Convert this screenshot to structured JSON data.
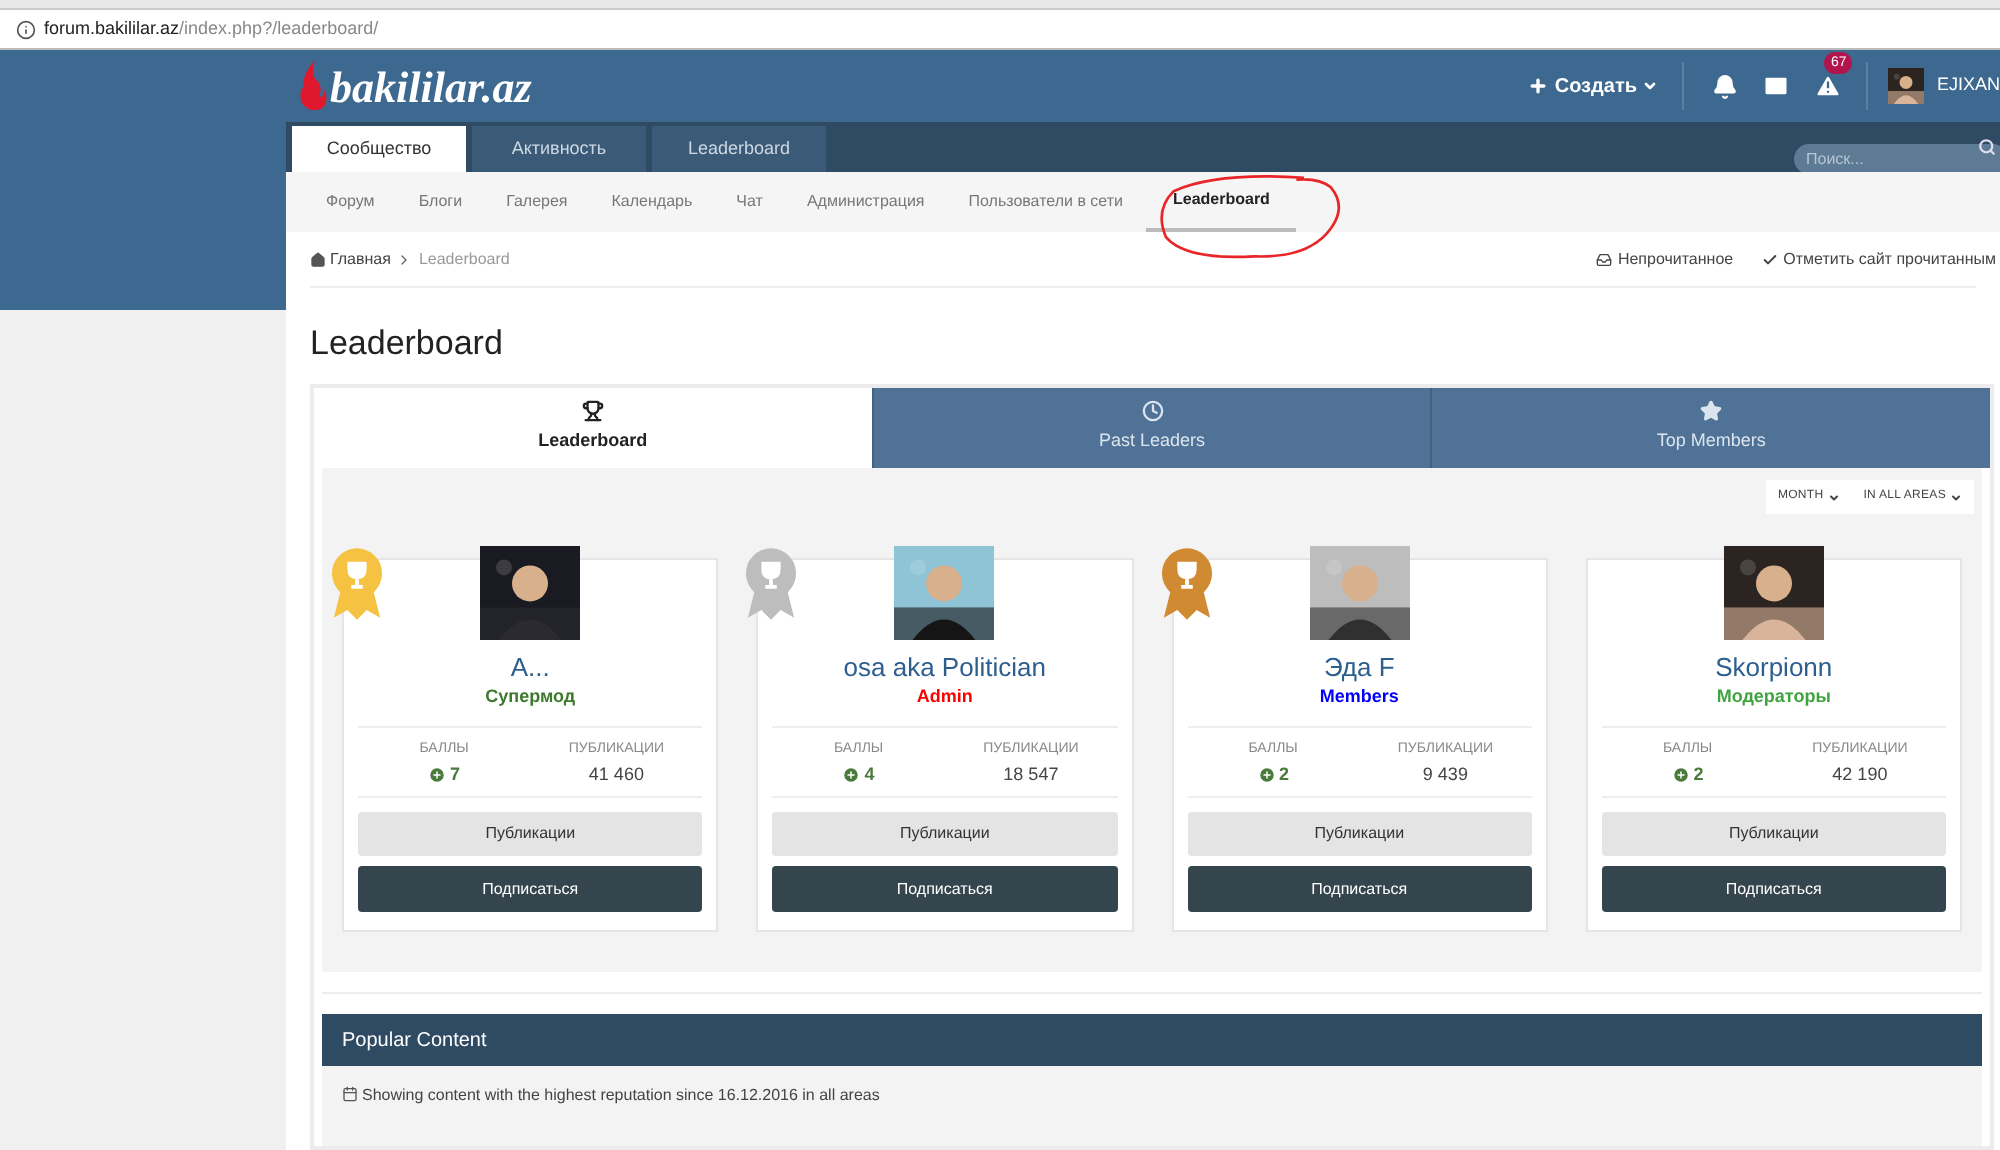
{
  "browser": {
    "url_host": "forum.bakililar.az",
    "url_path": "/index.php?/leaderboard/"
  },
  "header": {
    "logo": "bakililar.az",
    "create_button": "Создать",
    "notification_badge": "67",
    "username": "EJIXAN"
  },
  "nav": {
    "tabs": [
      {
        "label": "Сообщество",
        "selected": true
      },
      {
        "label": "Активность",
        "selected": false
      },
      {
        "label": "Leaderboard",
        "selected": false
      }
    ],
    "search": {
      "placeholder": "Поиск..."
    }
  },
  "subnav": [
    {
      "label": "Форум",
      "selected": false
    },
    {
      "label": "Блоги",
      "selected": false
    },
    {
      "label": "Галерея",
      "selected": false
    },
    {
      "label": "Календарь",
      "selected": false
    },
    {
      "label": "Чат",
      "selected": false
    },
    {
      "label": "Администрация",
      "selected": false
    },
    {
      "label": "Пользователи в сети",
      "selected": false
    },
    {
      "label": "Leaderboard",
      "selected": true
    }
  ],
  "breadcrumb": {
    "items": [
      "Главная",
      "Leaderboard"
    ],
    "actions": [
      {
        "kind": "unread",
        "label": "Непрочитанное"
      },
      {
        "kind": "mark",
        "label": "Отметить сайт прочитанным"
      }
    ]
  },
  "page_title": "Leaderboard",
  "tabs": [
    {
      "kind": "trophy",
      "label": "Leaderboard",
      "selected": true
    },
    {
      "kind": "clock",
      "label": "Past Leaders",
      "selected": false
    },
    {
      "kind": "star",
      "label": "Top Members",
      "selected": false
    }
  ],
  "filters": [
    "MONTH",
    "IN ALL AREAS"
  ],
  "leaders": [
    {
      "name": "A...",
      "role": {
        "text": "Супермод",
        "color": "#3d7a2e"
      },
      "award": {
        "color": "#f5c242"
      },
      "points_label": "БАЛЛЫ",
      "points": "7",
      "posts_label": "ПУБЛИКАЦИИ",
      "posts": "41 460",
      "buttons": [
        "Публикации",
        "Подписаться"
      ]
    },
    {
      "name": "osa aka Politician",
      "role": {
        "text": "Admin",
        "color": "#ff0000"
      },
      "award": {
        "color": "#bdbdbd"
      },
      "points_label": "БАЛЛЫ",
      "points": "4",
      "posts_label": "ПУБЛИКАЦИИ",
      "posts": "18 547",
      "buttons": [
        "Публикации",
        "Подписаться"
      ]
    },
    {
      "name": "Эда F",
      "role": {
        "text": "Members",
        "color": "#0000ff"
      },
      "award": {
        "color": "#d08a32"
      },
      "points_label": "БАЛЛЫ",
      "points": "2",
      "posts_label": "ПУБЛИКАЦИИ",
      "posts": "9 439",
      "buttons": [
        "Публикации",
        "Подписаться"
      ]
    },
    {
      "name": "Skorpionn",
      "role": {
        "text": "Модераторы",
        "color": "#3fa33f"
      },
      "points_label": "БАЛЛЫ",
      "points": "2",
      "posts_label": "ПУБЛИКАЦИИ",
      "posts": "42 190",
      "buttons": [
        "Публикации",
        "Подписаться"
      ]
    }
  ],
  "popular": {
    "title": "Popular Content",
    "note": "Showing content with the highest reputation since 16.12.2016 in all areas"
  }
}
